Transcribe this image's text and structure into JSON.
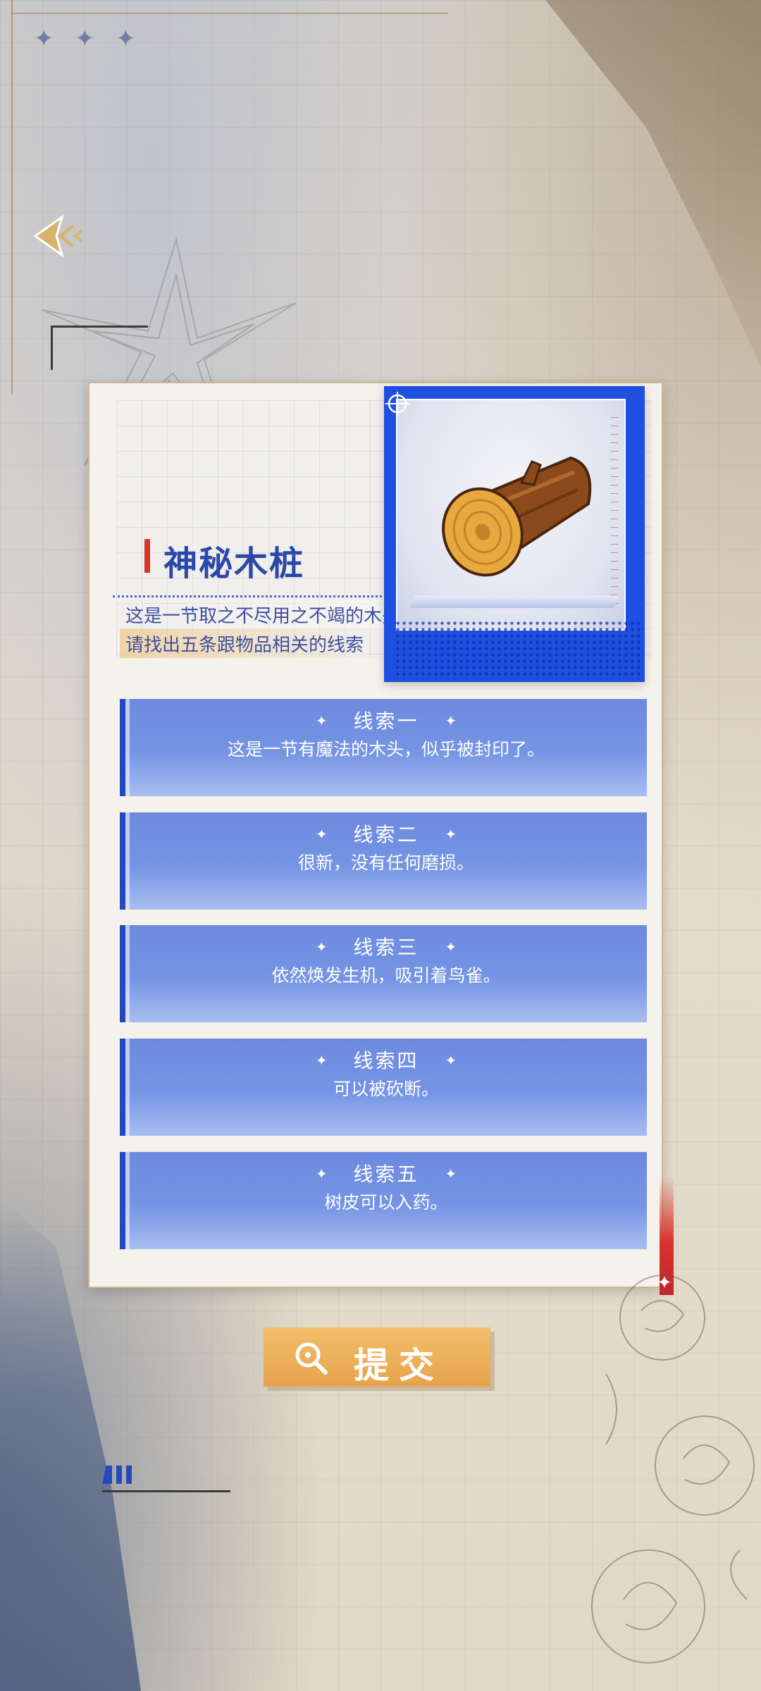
{
  "item": {
    "title": "神秘木桩",
    "description_lines": [
      "这是一节取之不尽用之不竭的木头。",
      "请找出五条跟物品相关的线索"
    ]
  },
  "clues": [
    {
      "title": "线索一",
      "text": "这是一节有魔法的木头，似乎被封印了。"
    },
    {
      "title": "线索二",
      "text": "很新，没有任何磨损。"
    },
    {
      "title": "线索三",
      "text": "依然焕发生机，吸引着鸟雀。"
    },
    {
      "title": "线索四",
      "text": "可以被砍断。"
    },
    {
      "title": "线索五",
      "text": "树皮可以入药。"
    }
  ],
  "submit": {
    "label": "提交",
    "icon": "magnifier-icon"
  },
  "nav": {
    "back_icon": "back-arrow-icon"
  },
  "colors": {
    "accent_blue": "#2747bd",
    "clue_blue": "#7594e4",
    "accent_red": "#d8342c",
    "button_orange": "#e6a24c"
  }
}
